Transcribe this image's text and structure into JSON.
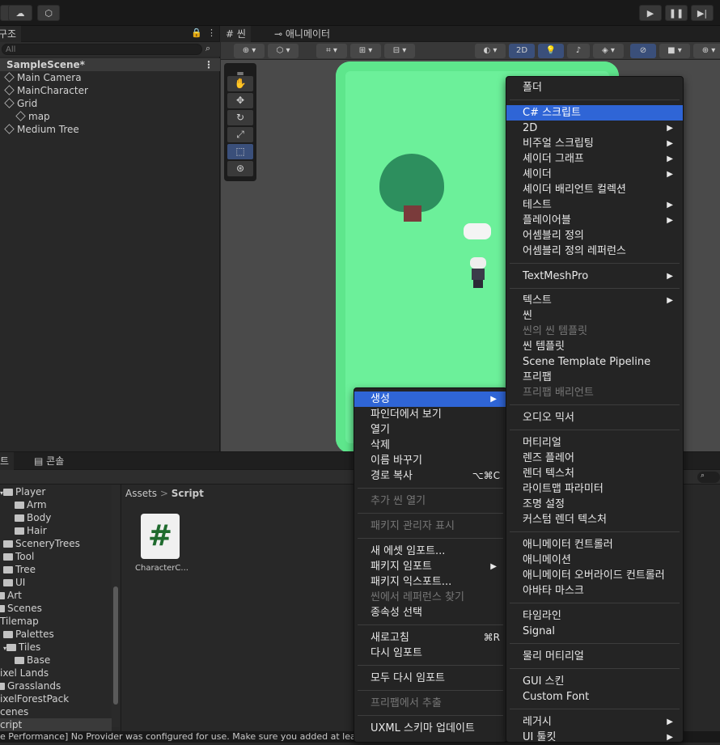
{
  "hierarchy": {
    "tab_label": "구조",
    "search_placeholder": "All",
    "scene_name": "SampleScene*",
    "items": [
      "Main Camera",
      "MainCharacter",
      "Grid",
      "map",
      "Medium Tree"
    ]
  },
  "scene_view": {
    "tabs": [
      "씬",
      "애니메이터"
    ],
    "toolbar": {
      "mode_2d": "2D"
    }
  },
  "project": {
    "tabs": [
      "트",
      "콘솔"
    ],
    "breadcrumb": [
      "Assets",
      "Script"
    ],
    "tree": [
      "Player",
      "Arm",
      "Body",
      "Hair",
      "SceneryTrees",
      "Tool",
      "Tree",
      "UI",
      "Art",
      "Scenes",
      "Tilemap",
      "Palettes",
      "Tiles",
      "Base",
      "ixel Lands",
      "Grasslands",
      "ixelForestPack",
      "cenes",
      "cript"
    ],
    "asset": {
      "name": "CharacterC...",
      "glyph": "#"
    }
  },
  "status_text": "e Performance] No Provider was configured for use. Make sure you added at lea",
  "left_menu": {
    "items": [
      {
        "label": "생성",
        "hl": true,
        "arrow": "▶"
      },
      {
        "label": "파인더에서 보기"
      },
      {
        "label": "열기"
      },
      {
        "label": "삭제"
      },
      {
        "label": "이름 바꾸기"
      },
      {
        "label": "경로 복사",
        "shortcut": "⌥⌘C"
      },
      {
        "label": "추가 씬 열기",
        "dis": true
      },
      {
        "label": "패키지 관리자 표시",
        "dis": true
      },
      {
        "label": "새 에셋 임포트..."
      },
      {
        "label": "패키지 임포트",
        "arrow": "▶"
      },
      {
        "label": "패키지 익스포트..."
      },
      {
        "label": "씬에서 레퍼런스 찾기",
        "dis": true
      },
      {
        "label": "종속성 선택"
      },
      {
        "label": "새로고침",
        "shortcut": "⌘R"
      },
      {
        "label": "다시 임포트"
      },
      {
        "label": "모두 다시 임포트"
      },
      {
        "label": "프리팹에서 추출",
        "dis": true
      },
      {
        "label": "UXML 스키마 업데이트"
      }
    ]
  },
  "right_menu": {
    "items": [
      {
        "label": "폴더"
      },
      {
        "label": "C# 스크립트",
        "hl": true
      },
      {
        "label": "2D",
        "arrow": "▶"
      },
      {
        "label": "비주얼 스크립팅",
        "arrow": "▶"
      },
      {
        "label": "셰이더 그래프",
        "arrow": "▶"
      },
      {
        "label": "셰이더",
        "arrow": "▶"
      },
      {
        "label": "셰이더 배리언트 컬렉션"
      },
      {
        "label": "테스트",
        "arrow": "▶"
      },
      {
        "label": "플레이어블",
        "arrow": "▶"
      },
      {
        "label": "어셈블리 정의"
      },
      {
        "label": "어셈블리 정의 레퍼런스"
      },
      {
        "label": "TextMeshPro",
        "arrow": "▶"
      },
      {
        "label": "텍스트",
        "arrow": "▶"
      },
      {
        "label": "씬"
      },
      {
        "label": "씬의 씬 템플릿",
        "dis": true
      },
      {
        "label": "씬 템플릿"
      },
      {
        "label": "Scene Template Pipeline"
      },
      {
        "label": "프리팹"
      },
      {
        "label": "프리팹 배리언트",
        "dis": true
      },
      {
        "label": "오디오 믹서"
      },
      {
        "label": "머티리얼"
      },
      {
        "label": "렌즈 플레어"
      },
      {
        "label": "렌더 텍스처"
      },
      {
        "label": "라이트맵 파라미터"
      },
      {
        "label": "조명 설정"
      },
      {
        "label": "커스텀 렌더 텍스처"
      },
      {
        "label": "애니메이터 컨트롤러"
      },
      {
        "label": "애니메이션"
      },
      {
        "label": "애니메이터 오버라이드 컨트롤러"
      },
      {
        "label": "아바타 마스크"
      },
      {
        "label": "타임라인"
      },
      {
        "label": "Signal"
      },
      {
        "label": "물리 머티리얼"
      },
      {
        "label": "GUI 스킨"
      },
      {
        "label": "Custom Font"
      },
      {
        "label": "레거시",
        "arrow": "▶"
      },
      {
        "label": "UI 툴킷",
        "arrow": "▶"
      }
    ]
  },
  "colors": {
    "highlight": "#2f65d6",
    "grass": "#6cf09a",
    "menu_bg": "#242424"
  }
}
